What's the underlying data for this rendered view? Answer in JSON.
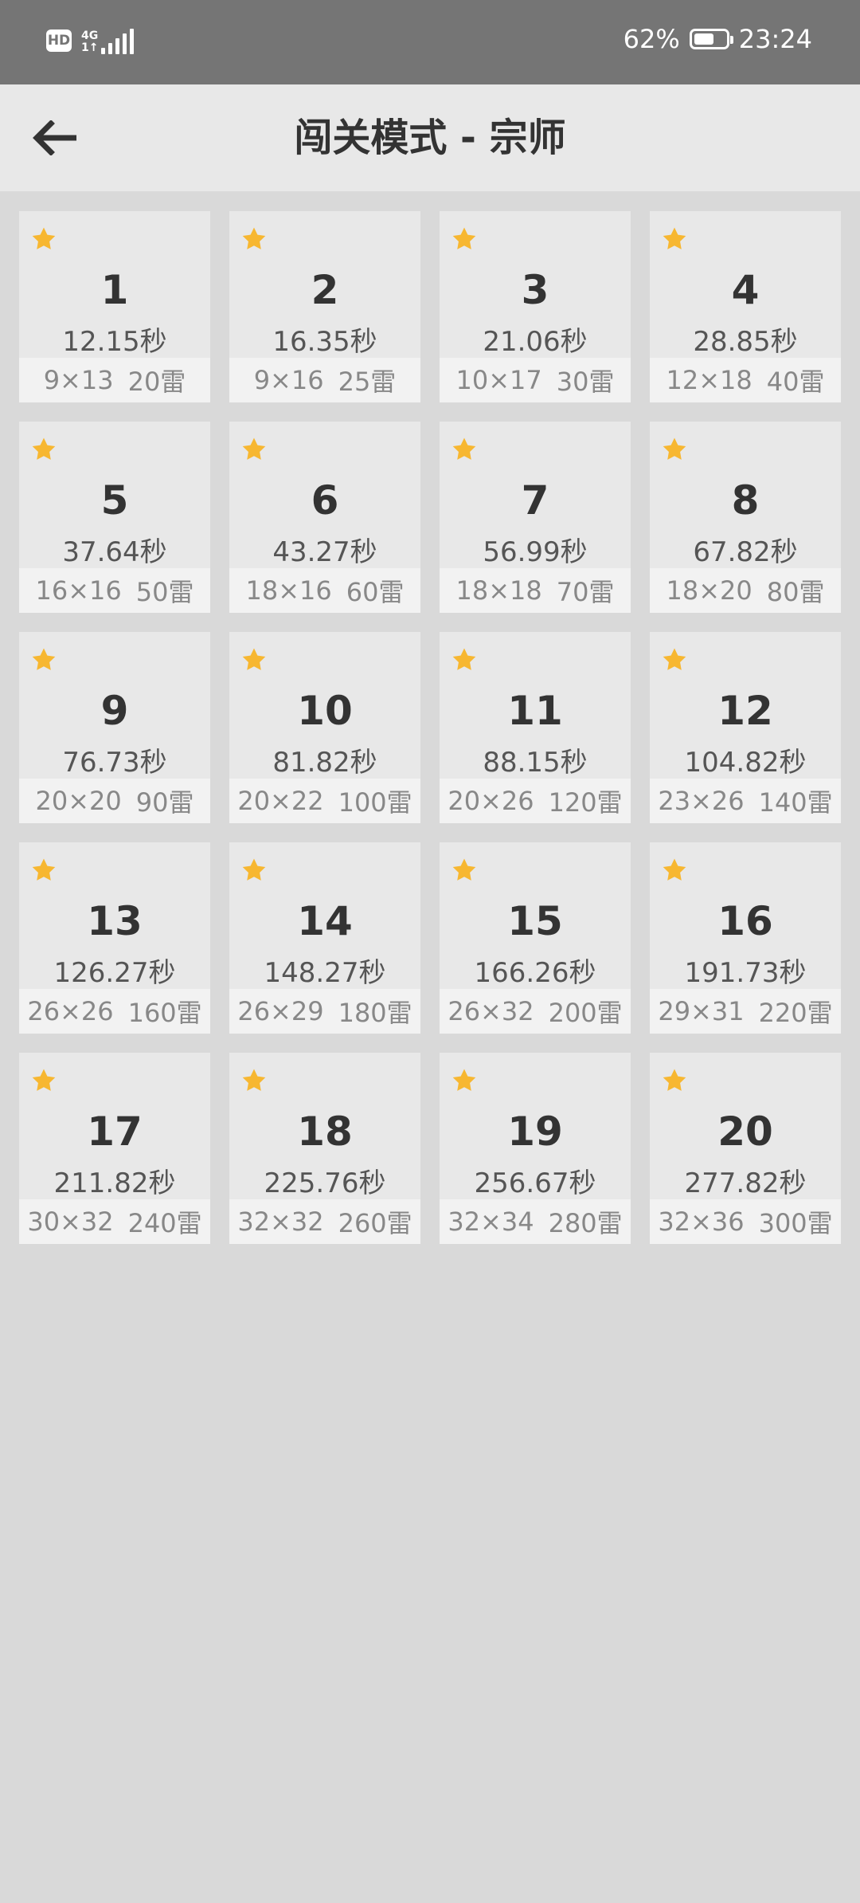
{
  "status_bar": {
    "hd": "HD",
    "network_top": "4G",
    "network_bottom": "1↑",
    "battery_percent": "62%",
    "battery_level": 0.62,
    "time": "23:24"
  },
  "header": {
    "title": "闯关模式 - 宗师",
    "back_icon": "arrow-left-icon"
  },
  "colors": {
    "status_bar_bg": "#757575",
    "header_bg": "#e8e8e8",
    "page_bg": "#d9d9d9",
    "card_bg": "#e8e8e8",
    "star": "#f7b731"
  },
  "levels": [
    {
      "number": "1",
      "time": "12.15秒",
      "size": "9×13",
      "mines": "20雷",
      "starred": true
    },
    {
      "number": "2",
      "time": "16.35秒",
      "size": "9×16",
      "mines": "25雷",
      "starred": true
    },
    {
      "number": "3",
      "time": "21.06秒",
      "size": "10×17",
      "mines": "30雷",
      "starred": true
    },
    {
      "number": "4",
      "time": "28.85秒",
      "size": "12×18",
      "mines": "40雷",
      "starred": true
    },
    {
      "number": "5",
      "time": "37.64秒",
      "size": "16×16",
      "mines": "50雷",
      "starred": true
    },
    {
      "number": "6",
      "time": "43.27秒",
      "size": "18×16",
      "mines": "60雷",
      "starred": true
    },
    {
      "number": "7",
      "time": "56.99秒",
      "size": "18×18",
      "mines": "70雷",
      "starred": true
    },
    {
      "number": "8",
      "time": "67.82秒",
      "size": "18×20",
      "mines": "80雷",
      "starred": true
    },
    {
      "number": "9",
      "time": "76.73秒",
      "size": "20×20",
      "mines": "90雷",
      "starred": true
    },
    {
      "number": "10",
      "time": "81.82秒",
      "size": "20×22",
      "mines": "100雷",
      "starred": true
    },
    {
      "number": "11",
      "time": "88.15秒",
      "size": "20×26",
      "mines": "120雷",
      "starred": true
    },
    {
      "number": "12",
      "time": "104.82秒",
      "size": "23×26",
      "mines": "140雷",
      "starred": true
    },
    {
      "number": "13",
      "time": "126.27秒",
      "size": "26×26",
      "mines": "160雷",
      "starred": true
    },
    {
      "number": "14",
      "time": "148.27秒",
      "size": "26×29",
      "mines": "180雷",
      "starred": true
    },
    {
      "number": "15",
      "time": "166.26秒",
      "size": "26×32",
      "mines": "200雷",
      "starred": true
    },
    {
      "number": "16",
      "time": "191.73秒",
      "size": "29×31",
      "mines": "220雷",
      "starred": true
    },
    {
      "number": "17",
      "time": "211.82秒",
      "size": "30×32",
      "mines": "240雷",
      "starred": true
    },
    {
      "number": "18",
      "time": "225.76秒",
      "size": "32×32",
      "mines": "260雷",
      "starred": true
    },
    {
      "number": "19",
      "time": "256.67秒",
      "size": "32×34",
      "mines": "280雷",
      "starred": true
    },
    {
      "number": "20",
      "time": "277.82秒",
      "size": "32×36",
      "mines": "300雷",
      "starred": true
    }
  ]
}
